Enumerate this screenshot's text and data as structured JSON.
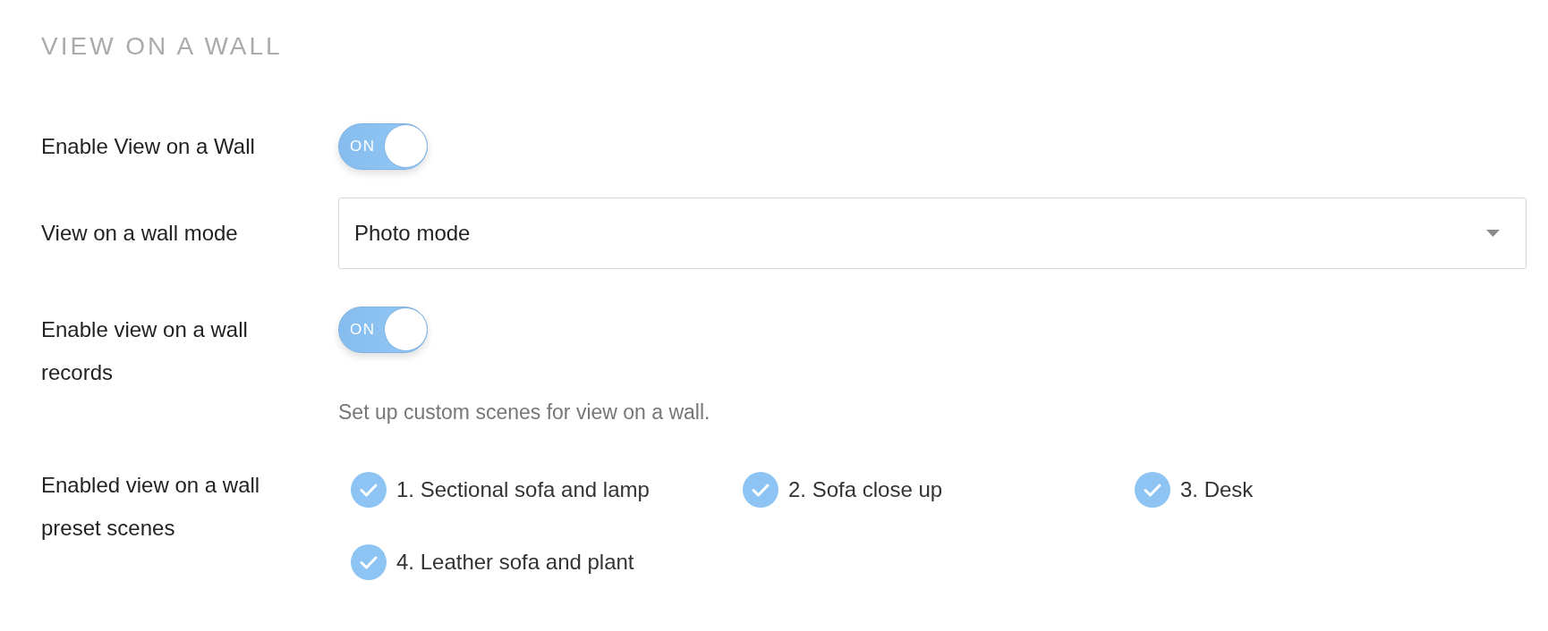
{
  "section": {
    "title": "VIEW ON A WALL"
  },
  "settings": [
    {
      "kind": "toggle",
      "label": "Enable View on a Wall",
      "on": true,
      "toggle_text": "ON"
    },
    {
      "kind": "select",
      "label": "View on a wall mode",
      "value": "Photo mode"
    },
    {
      "kind": "toggle",
      "label": "Enable view on a wall records",
      "on": true,
      "toggle_text": "ON"
    },
    {
      "kind": "note",
      "text": "Set up custom scenes for view on a wall."
    },
    {
      "kind": "checklist",
      "label": "Enabled view on a wall preset scenes",
      "options": [
        {
          "label": "1. Sectional sofa and lamp",
          "checked": true
        },
        {
          "label": "2. Sofa close up",
          "checked": true
        },
        {
          "label": "3. Desk",
          "checked": true
        },
        {
          "label": "4. Leather sofa and plant",
          "checked": true
        }
      ]
    }
  ]
}
